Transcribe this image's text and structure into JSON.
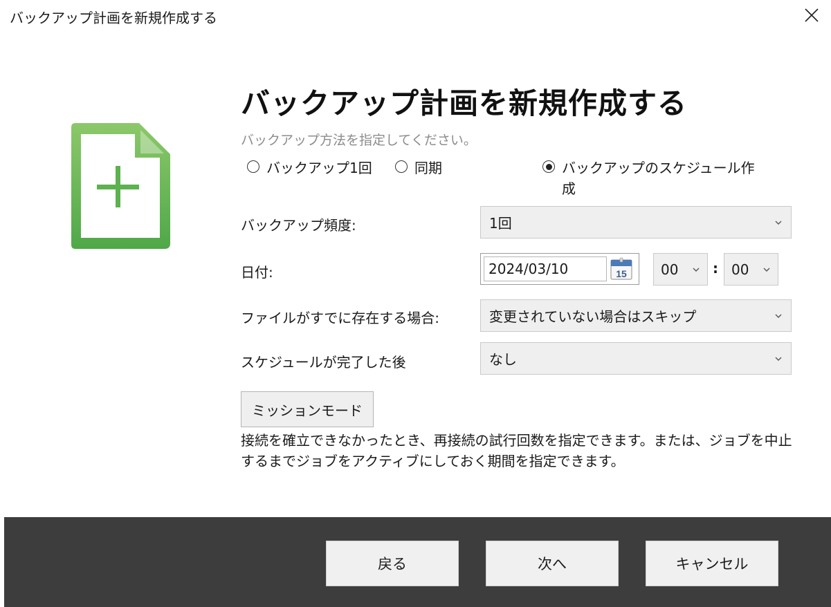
{
  "window": {
    "title": "バックアップ計画を新規作成する"
  },
  "main": {
    "heading": "バックアップ計画を新規作成する",
    "subtitle": "バックアップ方法を指定してください。",
    "backup_methods": [
      {
        "label": "バックアップ1回",
        "selected": false
      },
      {
        "label": "同期",
        "selected": false
      },
      {
        "label": "バックアップのスケジュール作",
        "label_cont": "成",
        "selected": true
      }
    ],
    "frequency": {
      "label": "バックアップ頻度:",
      "value": "1回"
    },
    "date": {
      "label": "日付:",
      "value": "2024/03/10",
      "calendar_day": "15",
      "hour": "00",
      "minute": "00",
      "separator": ":"
    },
    "file_exists": {
      "label": "ファイルがすでに存在する場合:",
      "value": "変更されていない場合はスキップ"
    },
    "after_schedule": {
      "label": "スケジュールが完了した後",
      "value": "なし"
    },
    "mission_mode": {
      "label": "ミッションモード"
    },
    "description": {
      "line1": "接続を確立できなかったとき、再接続の試行回数を指定できます。または、ジョブを中止",
      "line2": "するまでジョブをアクティブにしておく期間を指定できます。"
    }
  },
  "footer": {
    "back": "戻る",
    "next": "次へ",
    "cancel": "キャンセル"
  },
  "colors": {
    "icon_green_light": "#8cc86a",
    "icon_green_dark": "#4fa848",
    "footer_bg": "#3d3d3d"
  }
}
